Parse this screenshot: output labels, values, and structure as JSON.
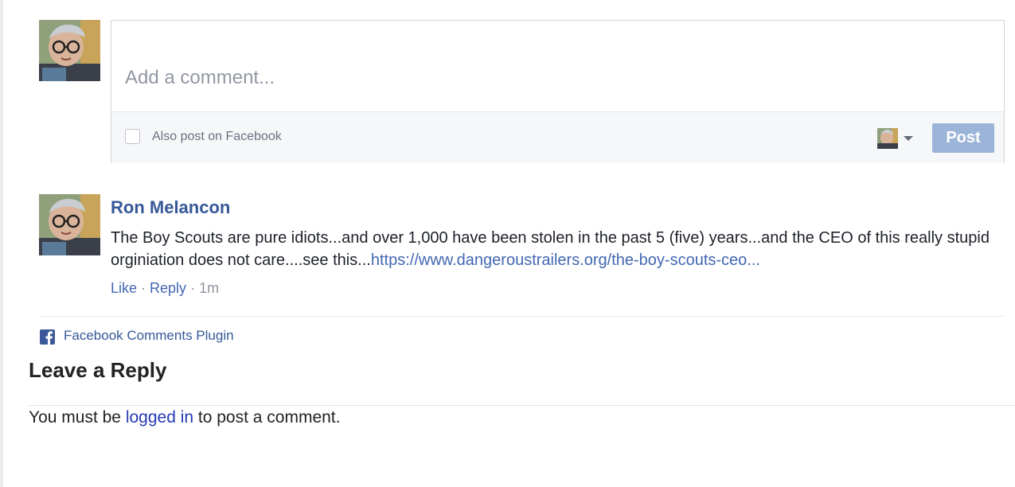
{
  "composer": {
    "placeholder": "Add a comment...",
    "also_post_label": "Also post on Facebook",
    "post_label": "Post"
  },
  "comment": {
    "author": "Ron Melancon",
    "text": "The Boy Scouts are pure idiots...and over 1,000 have been stolen in the past 5 (five) years...and the CEO of this really stupid orginiation does not care....see this...",
    "link_text": "https://www.dangeroustrailers.org/the-boy-scouts-ceo...",
    "like_label": "Like",
    "separator": " · ",
    "reply_label": "Reply",
    "time_ago": "1m"
  },
  "plugin": {
    "label": "Facebook Comments Plugin",
    "icon": "facebook-icon"
  },
  "reply_section": {
    "heading": "Leave a Reply",
    "note_before": "You must be ",
    "login_link": "logged in",
    "note_after": " to post a comment."
  },
  "colors": {
    "facebook_blue": "#3b5998",
    "link_blue": "#4267b2",
    "post_button": "#9cb4d8"
  }
}
